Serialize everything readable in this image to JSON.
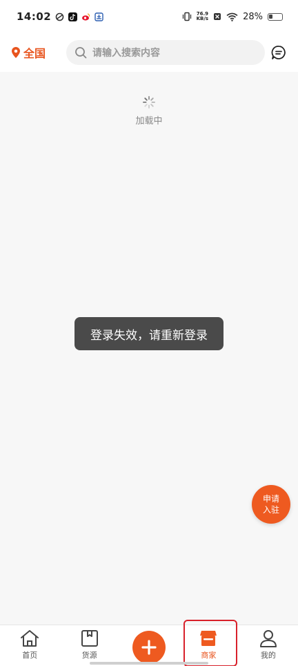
{
  "status_bar": {
    "time": "14:02",
    "net_speed_value": "76.9",
    "net_speed_unit": "KB/s",
    "battery": "28%"
  },
  "header": {
    "location": "全国",
    "search_placeholder": "请输入搜索内容"
  },
  "loading": {
    "text": "加载中"
  },
  "toast": {
    "text": "登录失效，请重新登录"
  },
  "apply_fab": {
    "line1": "申请",
    "line2": "入驻"
  },
  "bottom_nav": {
    "items": [
      {
        "label": "首页",
        "icon": "home-icon"
      },
      {
        "label": "货源",
        "icon": "box-icon"
      },
      {
        "label": "",
        "icon": "plus-icon"
      },
      {
        "label": "商家",
        "icon": "store-icon"
      },
      {
        "label": "我的",
        "icon": "user-icon"
      }
    ],
    "active": "商家"
  },
  "colors": {
    "accent": "#ee5a20",
    "highlight_box": "#d8202a",
    "toast_bg": "#4a4a4a"
  }
}
